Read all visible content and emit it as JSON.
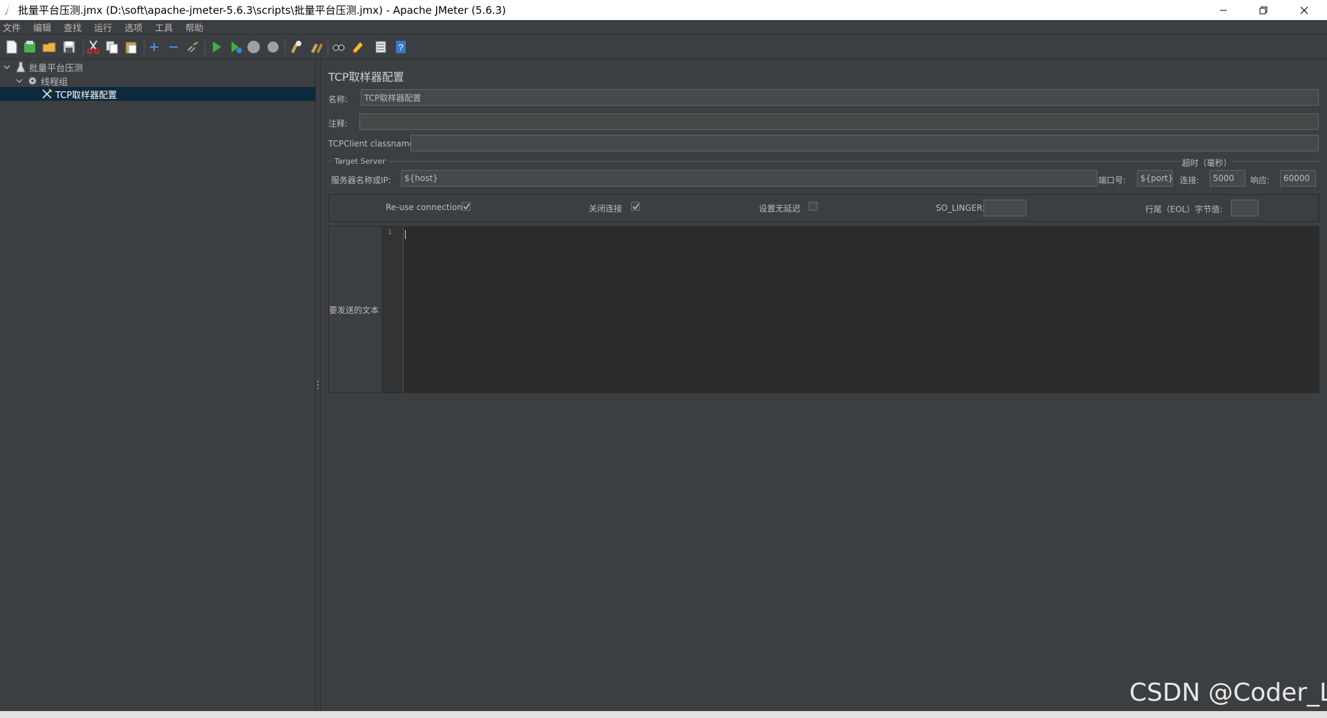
{
  "window": {
    "title": "批量平台压测.jmx (D:\\soft\\apache-jmeter-5.6.3\\scripts\\批量平台压测.jmx) - Apache JMeter (5.6.3)"
  },
  "menu": [
    "文件",
    "编辑",
    "查找",
    "运行",
    "选项",
    "工具",
    "帮助"
  ],
  "toolbar": {
    "icons": [
      "new-icon",
      "templates-icon",
      "open-icon",
      "save-icon",
      "cut-icon",
      "copy-icon",
      "paste-icon",
      "expand-icon",
      "collapse-icon",
      "toggle-icon",
      "start-icon",
      "start-no-pause-icon",
      "stop-icon",
      "shutdown-icon",
      "clear-icon",
      "clear-all-icon",
      "search-icon",
      "reset-search-icon",
      "function-helper-icon",
      "help-icon"
    ]
  },
  "tree": {
    "root": "批量平台压测",
    "thread_group": "线程组",
    "sampler": "TCP取样器配置"
  },
  "panel": {
    "heading": "TCP取样器配置",
    "name_label": "名称:",
    "name_value": "TCP取样器配置",
    "comment_label": "注释:",
    "comment_value": "",
    "classname_label": "TCPClient classname:",
    "classname_value": "",
    "target_server_title": "Target Server",
    "server_label": "服务器名称或IP:",
    "server_value": "${host}",
    "port_label": "端口号:",
    "port_value": "${port}",
    "timeout_title": "超时（毫秒）",
    "connect_label": "连接:",
    "connect_value": "5000",
    "response_label": "响应:",
    "response_value": "60000",
    "reuse_label": "Re-use connection",
    "reuse_checked": true,
    "close_label": "关闭连接",
    "close_checked": true,
    "nodelay_label": "设置无延迟",
    "nodelay_checked": false,
    "solinger_label": "SO_LINGER:",
    "solinger_value": "",
    "eol_label": "行尾（EOL）字节值:",
    "eol_value": "",
    "text_label": "要发送的文本",
    "line_number": "1"
  },
  "watermark": "CSDN @Coder_Li"
}
